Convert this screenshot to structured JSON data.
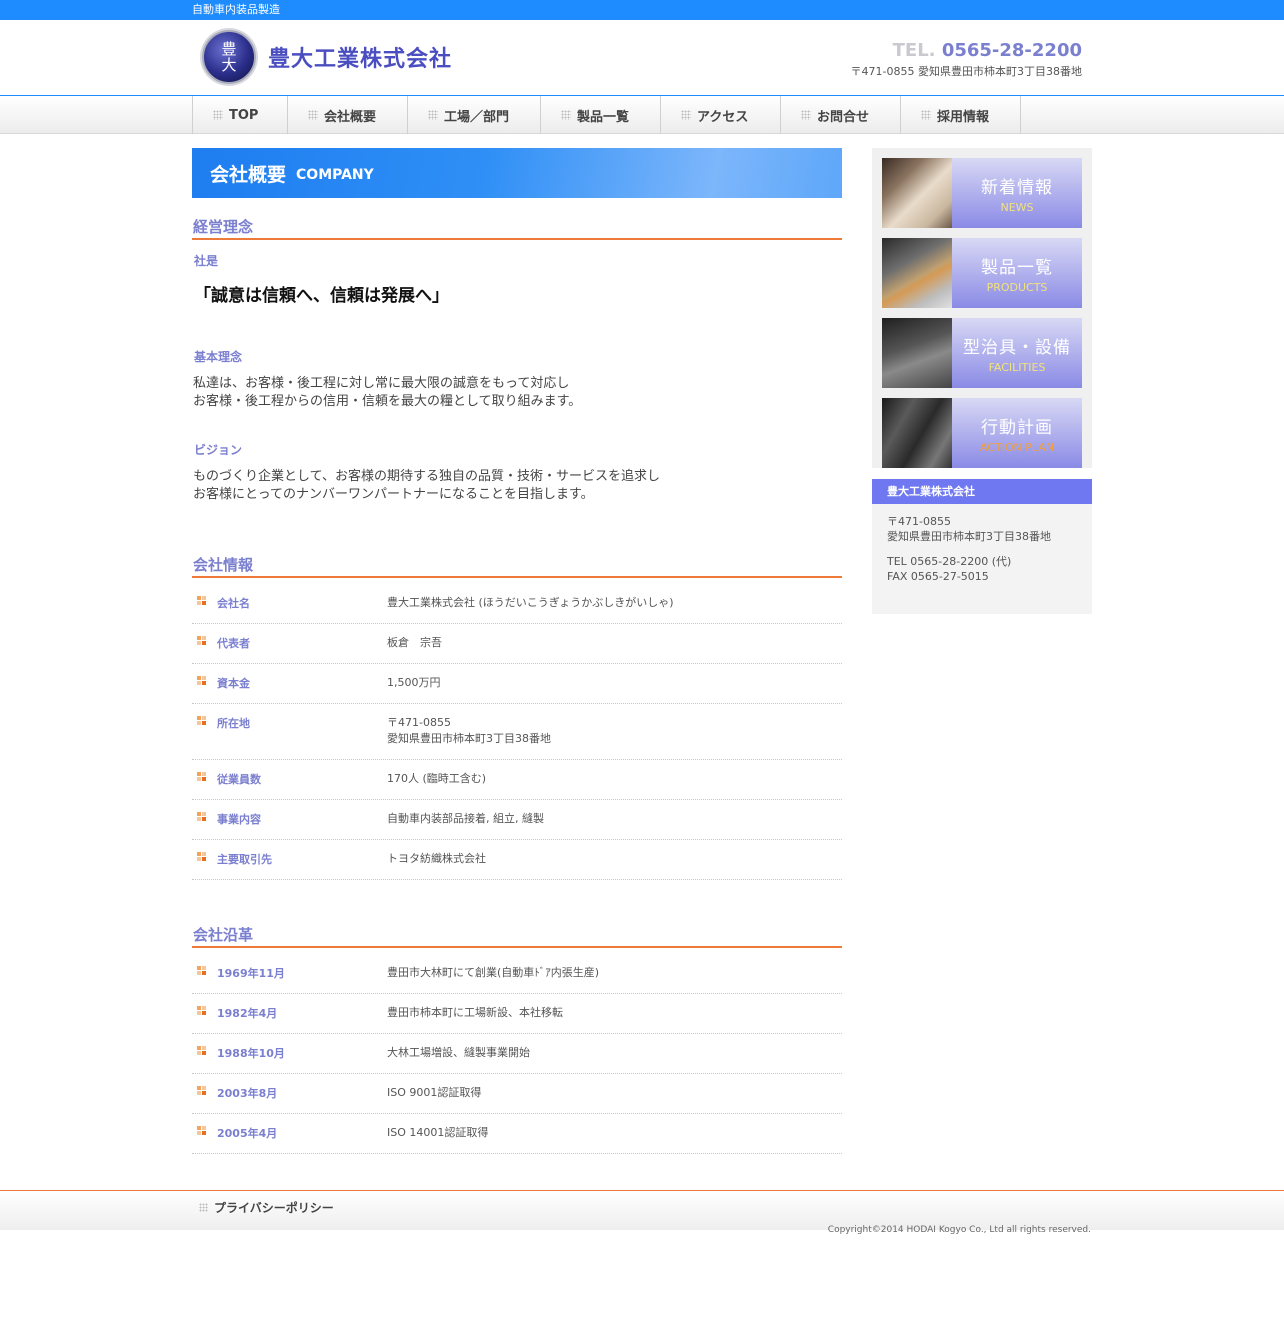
{
  "topbar": {
    "tagline": "自動車内装品製造"
  },
  "header": {
    "logo_line1": "豊",
    "logo_line2": "大",
    "company_name": "豊大工業株式会社",
    "tel_prefix": "TEL.",
    "tel_number": "0565-28-2200",
    "address": "〒471-0855 愛知県豊田市柿本町3丁目38番地"
  },
  "nav": {
    "items": [
      {
        "label": "TOP"
      },
      {
        "label": "会社概要"
      },
      {
        "label": "工場／部門"
      },
      {
        "label": "製品一覧"
      },
      {
        "label": "アクセス"
      },
      {
        "label": "お問合せ"
      },
      {
        "label": "採用情報"
      }
    ]
  },
  "main": {
    "title_ja": "会社概要",
    "title_en": "COMPANY",
    "philosophy": {
      "heading": "経営理念",
      "motto_label": "社是",
      "motto": "「誠意は信頼へ、信頼は発展へ」",
      "basic_label": "基本理念",
      "basic_line1": "私達は、お客様・後工程に対し常に最大限の誠意をもって対応し",
      "basic_line2": "お客様・後工程からの信用・信頼を最大の糧として取り組みます。",
      "vision_label": "ビジョン",
      "vision_line1": "ものづくり企業として、お客様の期待する独自の品質・技術・サービスを追求し",
      "vision_line2": "お客様にとってのナンバーワンパートナーになることを目指します。"
    },
    "info": {
      "heading": "会社情報",
      "rows": [
        {
          "key": "会社名",
          "val": "豊大工業株式会社 (ほうだいこうぎょうかぶしきがいしゃ)",
          "val2": ""
        },
        {
          "key": "代表者",
          "val": "板倉　宗吾",
          "val2": ""
        },
        {
          "key": "資本金",
          "val": "1,500万円",
          "val2": ""
        },
        {
          "key": "所在地",
          "val": "〒471-0855",
          "val2": "愛知県豊田市柿本町3丁目38番地"
        },
        {
          "key": "従業員数",
          "val": "170人 (臨時工含む)",
          "val2": ""
        },
        {
          "key": "事業内容",
          "val": "自動車内装部品接着, 組立, 縫製",
          "val2": ""
        },
        {
          "key": "主要取引先",
          "val": "トヨタ紡織株式会社",
          "val2": ""
        }
      ]
    },
    "history": {
      "heading": "会社沿革",
      "rows": [
        {
          "key": "1969年11月",
          "val": "豊田市大林町にて創業(自動車ﾄﾞｱ内張生産)"
        },
        {
          "key": "1982年4月",
          "val": "豊田市柿本町に工場新設、本社移転"
        },
        {
          "key": "1988年10月",
          "val": "大林工場増設、縫製事業開始"
        },
        {
          "key": "2003年8月",
          "val": "ISO 9001認証取得"
        },
        {
          "key": "2005年4月",
          "val": "ISO 14001認証取得"
        }
      ]
    }
  },
  "sidebar": {
    "banners": [
      {
        "ja": "新着情報",
        "en": "NEWS",
        "en_color": "#f2e27a"
      },
      {
        "ja": "製品一覧",
        "en": "PRODUCTS",
        "en_color": "#f2e27a"
      },
      {
        "ja": "型治具・設備",
        "en": "FACILITIES",
        "en_color": "#f2e27a"
      },
      {
        "ja": "行動計画",
        "en": "ACTION PLAN",
        "en_color": "#f0a040"
      }
    ],
    "box": {
      "title": "豊大工業株式会社",
      "zip": "〒471-0855",
      "address": "愛知県豊田市柿本町3丁目38番地",
      "tel": "TEL 0565-28-2200 (代)",
      "fax": "FAX 0565-27-5015"
    }
  },
  "footer": {
    "privacy_label": "プライバシーポリシー",
    "copyright": "Copyright©2014 HODAI Kogyo Co., Ltd all rights reserved."
  },
  "colors": {
    "topbar": "#1e8cff",
    "accent_text": "#7b7fcf",
    "heading_rule": "#ee7a3a",
    "side_box_title": "#6f78f0"
  }
}
